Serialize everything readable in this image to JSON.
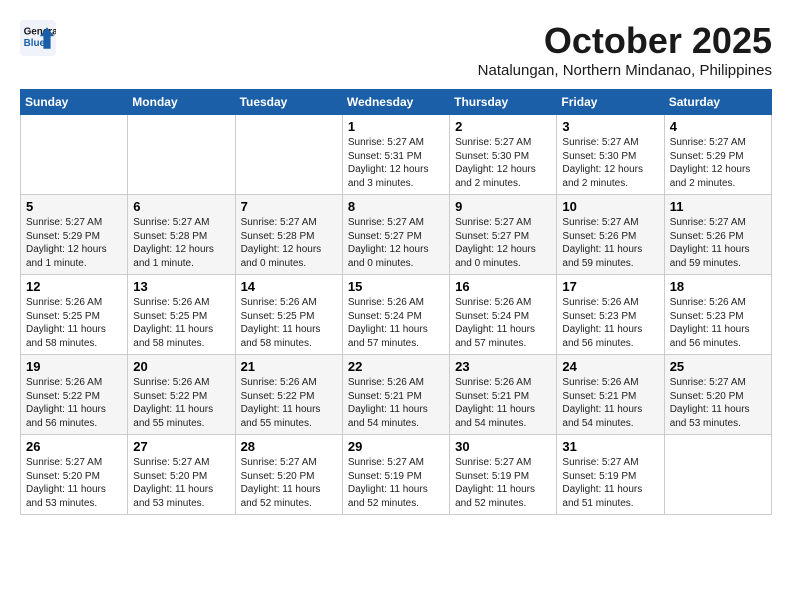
{
  "header": {
    "logo_line1": "General",
    "logo_line2": "Blue",
    "month": "October 2025",
    "location": "Natalungan, Northern Mindanao, Philippines"
  },
  "weekdays": [
    "Sunday",
    "Monday",
    "Tuesday",
    "Wednesday",
    "Thursday",
    "Friday",
    "Saturday"
  ],
  "weeks": [
    [
      {
        "day": "",
        "info": ""
      },
      {
        "day": "",
        "info": ""
      },
      {
        "day": "",
        "info": ""
      },
      {
        "day": "1",
        "info": "Sunrise: 5:27 AM\nSunset: 5:31 PM\nDaylight: 12 hours and 3 minutes."
      },
      {
        "day": "2",
        "info": "Sunrise: 5:27 AM\nSunset: 5:30 PM\nDaylight: 12 hours and 2 minutes."
      },
      {
        "day": "3",
        "info": "Sunrise: 5:27 AM\nSunset: 5:30 PM\nDaylight: 12 hours and 2 minutes."
      },
      {
        "day": "4",
        "info": "Sunrise: 5:27 AM\nSunset: 5:29 PM\nDaylight: 12 hours and 2 minutes."
      }
    ],
    [
      {
        "day": "5",
        "info": "Sunrise: 5:27 AM\nSunset: 5:29 PM\nDaylight: 12 hours and 1 minute."
      },
      {
        "day": "6",
        "info": "Sunrise: 5:27 AM\nSunset: 5:28 PM\nDaylight: 12 hours and 1 minute."
      },
      {
        "day": "7",
        "info": "Sunrise: 5:27 AM\nSunset: 5:28 PM\nDaylight: 12 hours and 0 minutes."
      },
      {
        "day": "8",
        "info": "Sunrise: 5:27 AM\nSunset: 5:27 PM\nDaylight: 12 hours and 0 minutes."
      },
      {
        "day": "9",
        "info": "Sunrise: 5:27 AM\nSunset: 5:27 PM\nDaylight: 12 hours and 0 minutes."
      },
      {
        "day": "10",
        "info": "Sunrise: 5:27 AM\nSunset: 5:26 PM\nDaylight: 11 hours and 59 minutes."
      },
      {
        "day": "11",
        "info": "Sunrise: 5:27 AM\nSunset: 5:26 PM\nDaylight: 11 hours and 59 minutes."
      }
    ],
    [
      {
        "day": "12",
        "info": "Sunrise: 5:26 AM\nSunset: 5:25 PM\nDaylight: 11 hours and 58 minutes."
      },
      {
        "day": "13",
        "info": "Sunrise: 5:26 AM\nSunset: 5:25 PM\nDaylight: 11 hours and 58 minutes."
      },
      {
        "day": "14",
        "info": "Sunrise: 5:26 AM\nSunset: 5:25 PM\nDaylight: 11 hours and 58 minutes."
      },
      {
        "day": "15",
        "info": "Sunrise: 5:26 AM\nSunset: 5:24 PM\nDaylight: 11 hours and 57 minutes."
      },
      {
        "day": "16",
        "info": "Sunrise: 5:26 AM\nSunset: 5:24 PM\nDaylight: 11 hours and 57 minutes."
      },
      {
        "day": "17",
        "info": "Sunrise: 5:26 AM\nSunset: 5:23 PM\nDaylight: 11 hours and 56 minutes."
      },
      {
        "day": "18",
        "info": "Sunrise: 5:26 AM\nSunset: 5:23 PM\nDaylight: 11 hours and 56 minutes."
      }
    ],
    [
      {
        "day": "19",
        "info": "Sunrise: 5:26 AM\nSunset: 5:22 PM\nDaylight: 11 hours and 56 minutes."
      },
      {
        "day": "20",
        "info": "Sunrise: 5:26 AM\nSunset: 5:22 PM\nDaylight: 11 hours and 55 minutes."
      },
      {
        "day": "21",
        "info": "Sunrise: 5:26 AM\nSunset: 5:22 PM\nDaylight: 11 hours and 55 minutes."
      },
      {
        "day": "22",
        "info": "Sunrise: 5:26 AM\nSunset: 5:21 PM\nDaylight: 11 hours and 54 minutes."
      },
      {
        "day": "23",
        "info": "Sunrise: 5:26 AM\nSunset: 5:21 PM\nDaylight: 11 hours and 54 minutes."
      },
      {
        "day": "24",
        "info": "Sunrise: 5:26 AM\nSunset: 5:21 PM\nDaylight: 11 hours and 54 minutes."
      },
      {
        "day": "25",
        "info": "Sunrise: 5:27 AM\nSunset: 5:20 PM\nDaylight: 11 hours and 53 minutes."
      }
    ],
    [
      {
        "day": "26",
        "info": "Sunrise: 5:27 AM\nSunset: 5:20 PM\nDaylight: 11 hours and 53 minutes."
      },
      {
        "day": "27",
        "info": "Sunrise: 5:27 AM\nSunset: 5:20 PM\nDaylight: 11 hours and 53 minutes."
      },
      {
        "day": "28",
        "info": "Sunrise: 5:27 AM\nSunset: 5:20 PM\nDaylight: 11 hours and 52 minutes."
      },
      {
        "day": "29",
        "info": "Sunrise: 5:27 AM\nSunset: 5:19 PM\nDaylight: 11 hours and 52 minutes."
      },
      {
        "day": "30",
        "info": "Sunrise: 5:27 AM\nSunset: 5:19 PM\nDaylight: 11 hours and 52 minutes."
      },
      {
        "day": "31",
        "info": "Sunrise: 5:27 AM\nSunset: 5:19 PM\nDaylight: 11 hours and 51 minutes."
      },
      {
        "day": "",
        "info": ""
      }
    ]
  ]
}
